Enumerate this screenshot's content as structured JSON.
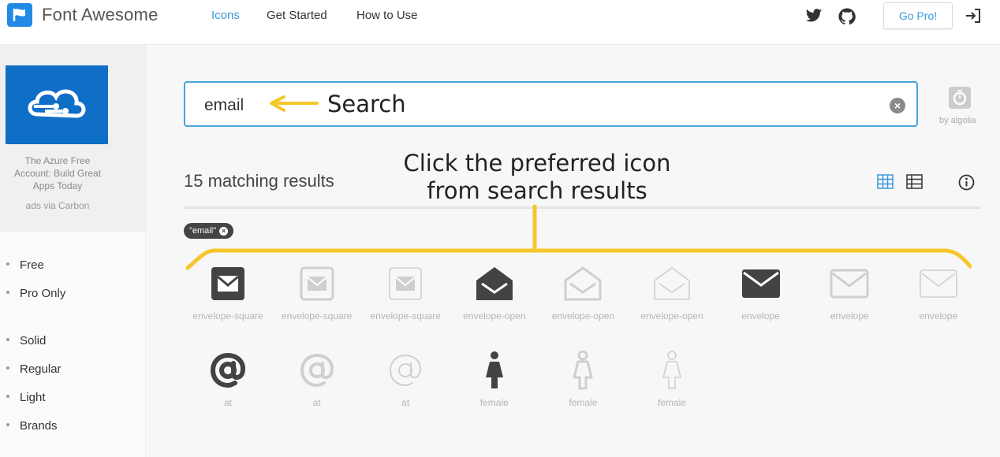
{
  "header": {
    "brand": "Font Awesome",
    "nav": [
      "Icons",
      "Get Started",
      "How to Use"
    ],
    "go_pro": "Go Pro!",
    "icons": [
      "flag-icon",
      "twitter-icon",
      "github-icon",
      "sign-in-icon"
    ]
  },
  "sidebar": {
    "ad_text": "The Azure Free Account: Build Great Apps Today",
    "ad_via": "ads via Carbon",
    "filters_license": [
      "Free",
      "Pro Only"
    ],
    "filters_style": [
      "Solid",
      "Regular",
      "Light",
      "Brands"
    ]
  },
  "search": {
    "value": "email",
    "annotation": "Search",
    "powered_by": "by algolia"
  },
  "results": {
    "count_text": "15 matching results",
    "annotation_line1": "Click the preferred icon",
    "annotation_line2": "from search results",
    "tag": "\"email\""
  },
  "icons": [
    {
      "name": "envelope-square",
      "style": "solid"
    },
    {
      "name": "envelope-square",
      "style": "regular"
    },
    {
      "name": "envelope-square",
      "style": "light"
    },
    {
      "name": "envelope-open",
      "style": "solid"
    },
    {
      "name": "envelope-open",
      "style": "regular"
    },
    {
      "name": "envelope-open",
      "style": "light"
    },
    {
      "name": "envelope",
      "style": "solid"
    },
    {
      "name": "envelope",
      "style": "regular"
    },
    {
      "name": "envelope",
      "style": "light"
    },
    {
      "name": "at",
      "style": "solid"
    },
    {
      "name": "at",
      "style": "regular"
    },
    {
      "name": "at",
      "style": "light"
    },
    {
      "name": "female",
      "style": "solid"
    },
    {
      "name": "female",
      "style": "regular"
    },
    {
      "name": "female",
      "style": "light"
    }
  ],
  "colors": {
    "accent": "#3a9ad9",
    "annotation_yellow": "#f5c72b",
    "solid_icon": "#434343",
    "faded_icon": "#cfcfcf",
    "ad_blue": "#0f6fc6"
  }
}
